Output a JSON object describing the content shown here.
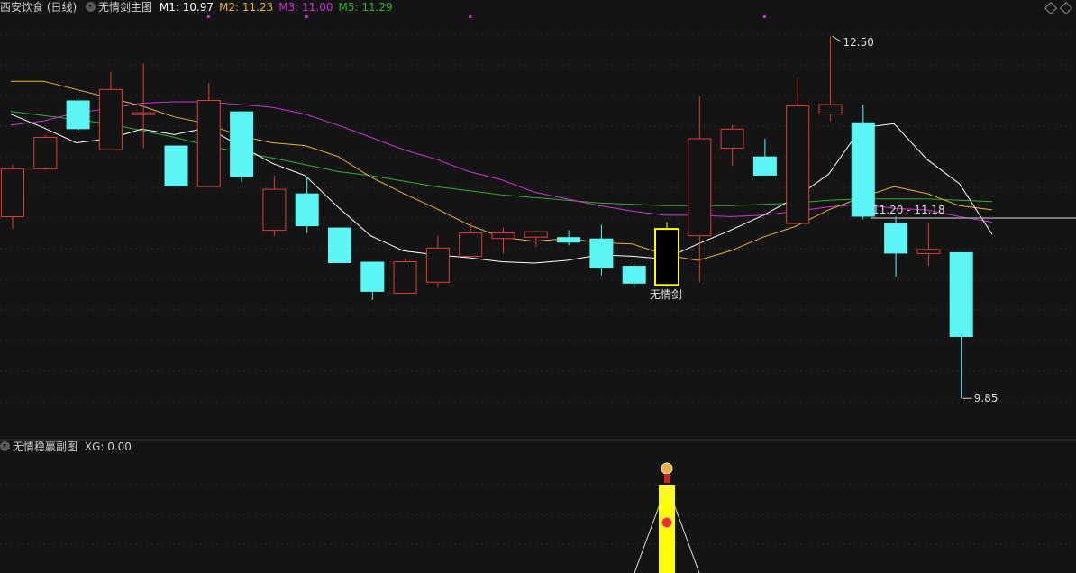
{
  "main_header": {
    "symbol": "西安饮食 (日线)",
    "indicator_name": "无情剑主图",
    "ma": [
      {
        "label": "M1: 10.97",
        "color": "#ffffff"
      },
      {
        "label": "M2: 11.23",
        "color": "#e6b422"
      },
      {
        "label": "M3: 11.00",
        "color": "#d030d8"
      },
      {
        "label": "M5: 11.29",
        "color": "#2cb02c"
      }
    ]
  },
  "sub_header": {
    "indicator_name": "无情稳赢副图",
    "xg_label": "XG: 0.00"
  },
  "colors": {
    "background": "#141414",
    "up": "#e03c3c",
    "down": "#5cf6f6",
    "signal": "#ffff00",
    "grid": "#2a2a2a",
    "m1": "#ffffff",
    "m2": "#e6b422",
    "m3": "#d030d8",
    "m5": "#2cb02c",
    "price_line": "#9a9a9a"
  },
  "chart_data": {
    "type": "candlestick",
    "ylim": [
      9.7,
      12.6
    ],
    "candles": [
      {
        "o": 11.18,
        "c": 11.53,
        "h": 11.56,
        "l": 11.09
      },
      {
        "o": 11.53,
        "c": 11.76,
        "h": 11.78,
        "l": 11.52
      },
      {
        "o": 12.03,
        "c": 11.82,
        "h": 12.05,
        "l": 11.79
      },
      {
        "o": 11.67,
        "c": 12.11,
        "h": 12.24,
        "l": 11.67
      },
      {
        "o": 11.93,
        "c": 11.94,
        "h": 12.3,
        "l": 11.68
      },
      {
        "o": 11.7,
        "c": 11.4,
        "h": 11.7,
        "l": 11.4
      },
      {
        "o": 11.4,
        "c": 12.03,
        "h": 12.16,
        "l": 11.4
      },
      {
        "o": 11.95,
        "c": 11.47,
        "h": 11.95,
        "l": 11.43
      },
      {
        "o": 11.08,
        "c": 11.38,
        "h": 11.48,
        "l": 11.04
      },
      {
        "o": 11.35,
        "c": 11.11,
        "h": 11.47,
        "l": 11.06
      },
      {
        "o": 11.1,
        "c": 10.84,
        "h": 11.1,
        "l": 10.84
      },
      {
        "o": 10.85,
        "c": 10.63,
        "h": 10.85,
        "l": 10.57
      },
      {
        "o": 10.62,
        "c": 10.85,
        "h": 10.87,
        "l": 10.62
      },
      {
        "o": 10.7,
        "c": 10.95,
        "h": 11.04,
        "l": 10.66
      },
      {
        "o": 10.89,
        "c": 11.06,
        "h": 11.14,
        "l": 10.89
      },
      {
        "o": 11.02,
        "c": 11.06,
        "h": 11.1,
        "l": 10.91
      },
      {
        "o": 11.03,
        "c": 11.07,
        "h": 11.08,
        "l": 10.96
      },
      {
        "o": 11.03,
        "c": 10.99,
        "h": 11.08,
        "l": 10.97
      },
      {
        "o": 11.02,
        "c": 10.8,
        "h": 11.12,
        "l": 10.75
      },
      {
        "o": 10.82,
        "c": 10.69,
        "h": 10.83,
        "l": 10.66
      },
      {
        "o": 10.68,
        "c": 11.09,
        "h": 11.14,
        "l": 10.67
      },
      {
        "o": 11.04,
        "c": 11.75,
        "h": 12.06,
        "l": 10.7
      },
      {
        "o": 11.68,
        "c": 11.82,
        "h": 11.85,
        "l": 11.55
      },
      {
        "o": 11.62,
        "c": 11.48,
        "h": 11.75,
        "l": 11.48
      },
      {
        "o": 11.13,
        "c": 11.99,
        "h": 12.19,
        "l": 11.13
      },
      {
        "o": 11.93,
        "c": 12.0,
        "h": 12.5,
        "l": 11.88
      },
      {
        "o": 11.87,
        "c": 11.18,
        "h": 12.0,
        "l": 11.16
      },
      {
        "o": 11.13,
        "c": 10.91,
        "h": 11.18,
        "l": 10.74
      },
      {
        "o": 10.91,
        "c": 10.94,
        "h": 11.13,
        "l": 10.82
      },
      {
        "o": 10.92,
        "c": 10.3,
        "h": 10.92,
        "l": 9.85
      }
    ],
    "signal_candle_index": 20,
    "signal_label": "无情剑",
    "m1": [
      11.93,
      11.83,
      11.72,
      11.75,
      11.82,
      11.78,
      11.83,
      11.7,
      11.57,
      11.48,
      11.25,
      11.04,
      10.93,
      10.9,
      10.88,
      10.85,
      10.84,
      10.86,
      10.9,
      10.89,
      10.87,
      10.98,
      11.08,
      11.19,
      11.32,
      11.49,
      11.83,
      11.86,
      11.6,
      11.42,
      11.05
    ],
    "m2": [
      12.17,
      12.17,
      12.11,
      12.05,
      11.99,
      11.91,
      11.86,
      11.77,
      11.72,
      11.7,
      11.62,
      11.47,
      11.35,
      11.24,
      11.12,
      11.03,
      11.0,
      11.02,
      10.99,
      10.98,
      10.9,
      10.86,
      10.93,
      11.03,
      11.11,
      11.23,
      11.32,
      11.4,
      11.35,
      11.26,
      11.23
    ],
    "m3": [
      11.85,
      11.88,
      11.94,
      11.97,
      12.01,
      12.02,
      12.02,
      12.0,
      11.98,
      11.93,
      11.85,
      11.76,
      11.67,
      11.6,
      11.51,
      11.45,
      11.36,
      11.31,
      11.26,
      11.22,
      11.19,
      11.19,
      11.18,
      11.19,
      11.22,
      11.25,
      11.27,
      11.24,
      11.23,
      11.18,
      11.14
    ],
    "m5": [
      11.95,
      11.92,
      11.89,
      11.86,
      11.81,
      11.76,
      11.7,
      11.65,
      11.61,
      11.56,
      11.51,
      11.48,
      11.44,
      11.4,
      11.37,
      11.34,
      11.32,
      11.3,
      11.28,
      11.27,
      11.26,
      11.26,
      11.26,
      11.27,
      11.28,
      11.3,
      11.31,
      11.31,
      11.31,
      11.3,
      11.29
    ],
    "max_annotation": "12.50",
    "min_annotation": "9.85",
    "range_label": "11.20 - 11.18",
    "top_markers": [
      6,
      9,
      14,
      23
    ]
  },
  "sub_chart": {
    "bar_candle_index": 20,
    "bar_color": "#ffff00"
  }
}
